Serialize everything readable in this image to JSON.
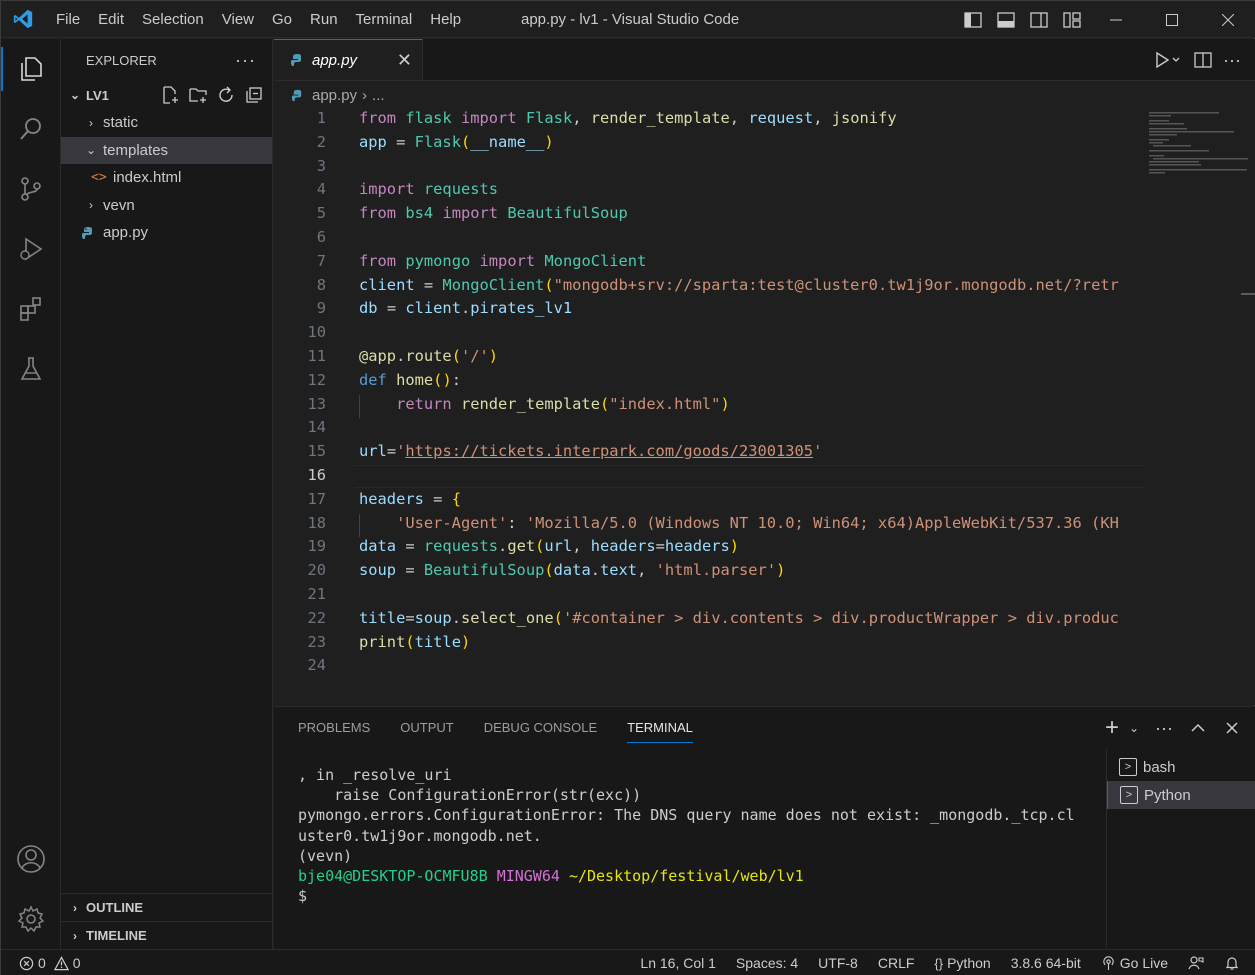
{
  "titlebar": {
    "menu": [
      "File",
      "Edit",
      "Selection",
      "View",
      "Go",
      "Run",
      "Terminal",
      "Help"
    ],
    "title": "app.py - lv1 - Visual Studio Code"
  },
  "explorer": {
    "header": "EXPLORER",
    "root": "LV1",
    "items": [
      {
        "label": "static",
        "kind": "folder"
      },
      {
        "label": "templates",
        "kind": "folder"
      },
      {
        "label": "index.html",
        "kind": "file"
      },
      {
        "label": "vevn",
        "kind": "folder"
      },
      {
        "label": "app.py",
        "kind": "file"
      }
    ],
    "outline": "OUTLINE",
    "timeline": "TIMELINE"
  },
  "editor": {
    "tab": "app.py",
    "breadcrumb": "app.py",
    "breadcrumb_more": "...",
    "current_line": 16,
    "line_count": 24
  },
  "panel": {
    "tabs": [
      "PROBLEMS",
      "OUTPUT",
      "DEBUG CONSOLE",
      "TERMINAL"
    ],
    "terminal_lines": [
      ", in _resolve_uri",
      "    raise ConfigurationError(str(exc))",
      "pymongo.errors.ConfigurationError: The DNS query name does not exist: _mongodb._tcp.cl",
      "uster0.tw1j9or.mongodb.net.",
      "(vevn)"
    ],
    "prompt_user": "bje04@DESKTOP-OCMFU8B",
    "prompt_env": "MINGW64",
    "prompt_path": "~/Desktop/festival/web/lv1",
    "prompt_symbol": "$",
    "terminals": [
      "bash",
      "Python"
    ]
  },
  "statusbar": {
    "errors": "0",
    "warnings": "0",
    "position": "Ln 16, Col 1",
    "spaces": "Spaces: 4",
    "encoding": "UTF-8",
    "eol": "CRLF",
    "language": "Python",
    "interpreter": "3.8.6 64-bit",
    "golive": "Go Live"
  },
  "colors": {
    "accent": "#0078d4",
    "keyword": "#c586c0",
    "function": "#dcdcaa",
    "class": "#4ec9b0",
    "string": "#ce9178",
    "variable": "#9cdcfe"
  }
}
